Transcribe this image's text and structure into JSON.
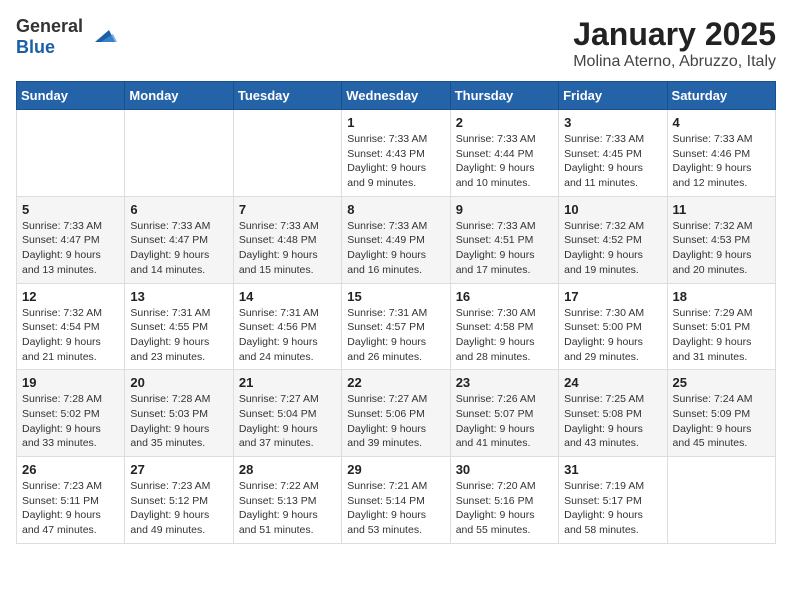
{
  "header": {
    "logo_line1": "General",
    "logo_line2": "Blue",
    "month_title": "January 2025",
    "location": "Molina Aterno, Abruzzo, Italy"
  },
  "days_of_week": [
    "Sunday",
    "Monday",
    "Tuesday",
    "Wednesday",
    "Thursday",
    "Friday",
    "Saturday"
  ],
  "weeks": [
    [
      {
        "day": "",
        "info": ""
      },
      {
        "day": "",
        "info": ""
      },
      {
        "day": "",
        "info": ""
      },
      {
        "day": "1",
        "info": "Sunrise: 7:33 AM\nSunset: 4:43 PM\nDaylight: 9 hours\nand 9 minutes."
      },
      {
        "day": "2",
        "info": "Sunrise: 7:33 AM\nSunset: 4:44 PM\nDaylight: 9 hours\nand 10 minutes."
      },
      {
        "day": "3",
        "info": "Sunrise: 7:33 AM\nSunset: 4:45 PM\nDaylight: 9 hours\nand 11 minutes."
      },
      {
        "day": "4",
        "info": "Sunrise: 7:33 AM\nSunset: 4:46 PM\nDaylight: 9 hours\nand 12 minutes."
      }
    ],
    [
      {
        "day": "5",
        "info": "Sunrise: 7:33 AM\nSunset: 4:47 PM\nDaylight: 9 hours\nand 13 minutes."
      },
      {
        "day": "6",
        "info": "Sunrise: 7:33 AM\nSunset: 4:47 PM\nDaylight: 9 hours\nand 14 minutes."
      },
      {
        "day": "7",
        "info": "Sunrise: 7:33 AM\nSunset: 4:48 PM\nDaylight: 9 hours\nand 15 minutes."
      },
      {
        "day": "8",
        "info": "Sunrise: 7:33 AM\nSunset: 4:49 PM\nDaylight: 9 hours\nand 16 minutes."
      },
      {
        "day": "9",
        "info": "Sunrise: 7:33 AM\nSunset: 4:51 PM\nDaylight: 9 hours\nand 17 minutes."
      },
      {
        "day": "10",
        "info": "Sunrise: 7:32 AM\nSunset: 4:52 PM\nDaylight: 9 hours\nand 19 minutes."
      },
      {
        "day": "11",
        "info": "Sunrise: 7:32 AM\nSunset: 4:53 PM\nDaylight: 9 hours\nand 20 minutes."
      }
    ],
    [
      {
        "day": "12",
        "info": "Sunrise: 7:32 AM\nSunset: 4:54 PM\nDaylight: 9 hours\nand 21 minutes."
      },
      {
        "day": "13",
        "info": "Sunrise: 7:31 AM\nSunset: 4:55 PM\nDaylight: 9 hours\nand 23 minutes."
      },
      {
        "day": "14",
        "info": "Sunrise: 7:31 AM\nSunset: 4:56 PM\nDaylight: 9 hours\nand 24 minutes."
      },
      {
        "day": "15",
        "info": "Sunrise: 7:31 AM\nSunset: 4:57 PM\nDaylight: 9 hours\nand 26 minutes."
      },
      {
        "day": "16",
        "info": "Sunrise: 7:30 AM\nSunset: 4:58 PM\nDaylight: 9 hours\nand 28 minutes."
      },
      {
        "day": "17",
        "info": "Sunrise: 7:30 AM\nSunset: 5:00 PM\nDaylight: 9 hours\nand 29 minutes."
      },
      {
        "day": "18",
        "info": "Sunrise: 7:29 AM\nSunset: 5:01 PM\nDaylight: 9 hours\nand 31 minutes."
      }
    ],
    [
      {
        "day": "19",
        "info": "Sunrise: 7:28 AM\nSunset: 5:02 PM\nDaylight: 9 hours\nand 33 minutes."
      },
      {
        "day": "20",
        "info": "Sunrise: 7:28 AM\nSunset: 5:03 PM\nDaylight: 9 hours\nand 35 minutes."
      },
      {
        "day": "21",
        "info": "Sunrise: 7:27 AM\nSunset: 5:04 PM\nDaylight: 9 hours\nand 37 minutes."
      },
      {
        "day": "22",
        "info": "Sunrise: 7:27 AM\nSunset: 5:06 PM\nDaylight: 9 hours\nand 39 minutes."
      },
      {
        "day": "23",
        "info": "Sunrise: 7:26 AM\nSunset: 5:07 PM\nDaylight: 9 hours\nand 41 minutes."
      },
      {
        "day": "24",
        "info": "Sunrise: 7:25 AM\nSunset: 5:08 PM\nDaylight: 9 hours\nand 43 minutes."
      },
      {
        "day": "25",
        "info": "Sunrise: 7:24 AM\nSunset: 5:09 PM\nDaylight: 9 hours\nand 45 minutes."
      }
    ],
    [
      {
        "day": "26",
        "info": "Sunrise: 7:23 AM\nSunset: 5:11 PM\nDaylight: 9 hours\nand 47 minutes."
      },
      {
        "day": "27",
        "info": "Sunrise: 7:23 AM\nSunset: 5:12 PM\nDaylight: 9 hours\nand 49 minutes."
      },
      {
        "day": "28",
        "info": "Sunrise: 7:22 AM\nSunset: 5:13 PM\nDaylight: 9 hours\nand 51 minutes."
      },
      {
        "day": "29",
        "info": "Sunrise: 7:21 AM\nSunset: 5:14 PM\nDaylight: 9 hours\nand 53 minutes."
      },
      {
        "day": "30",
        "info": "Sunrise: 7:20 AM\nSunset: 5:16 PM\nDaylight: 9 hours\nand 55 minutes."
      },
      {
        "day": "31",
        "info": "Sunrise: 7:19 AM\nSunset: 5:17 PM\nDaylight: 9 hours\nand 58 minutes."
      },
      {
        "day": "",
        "info": ""
      }
    ]
  ]
}
